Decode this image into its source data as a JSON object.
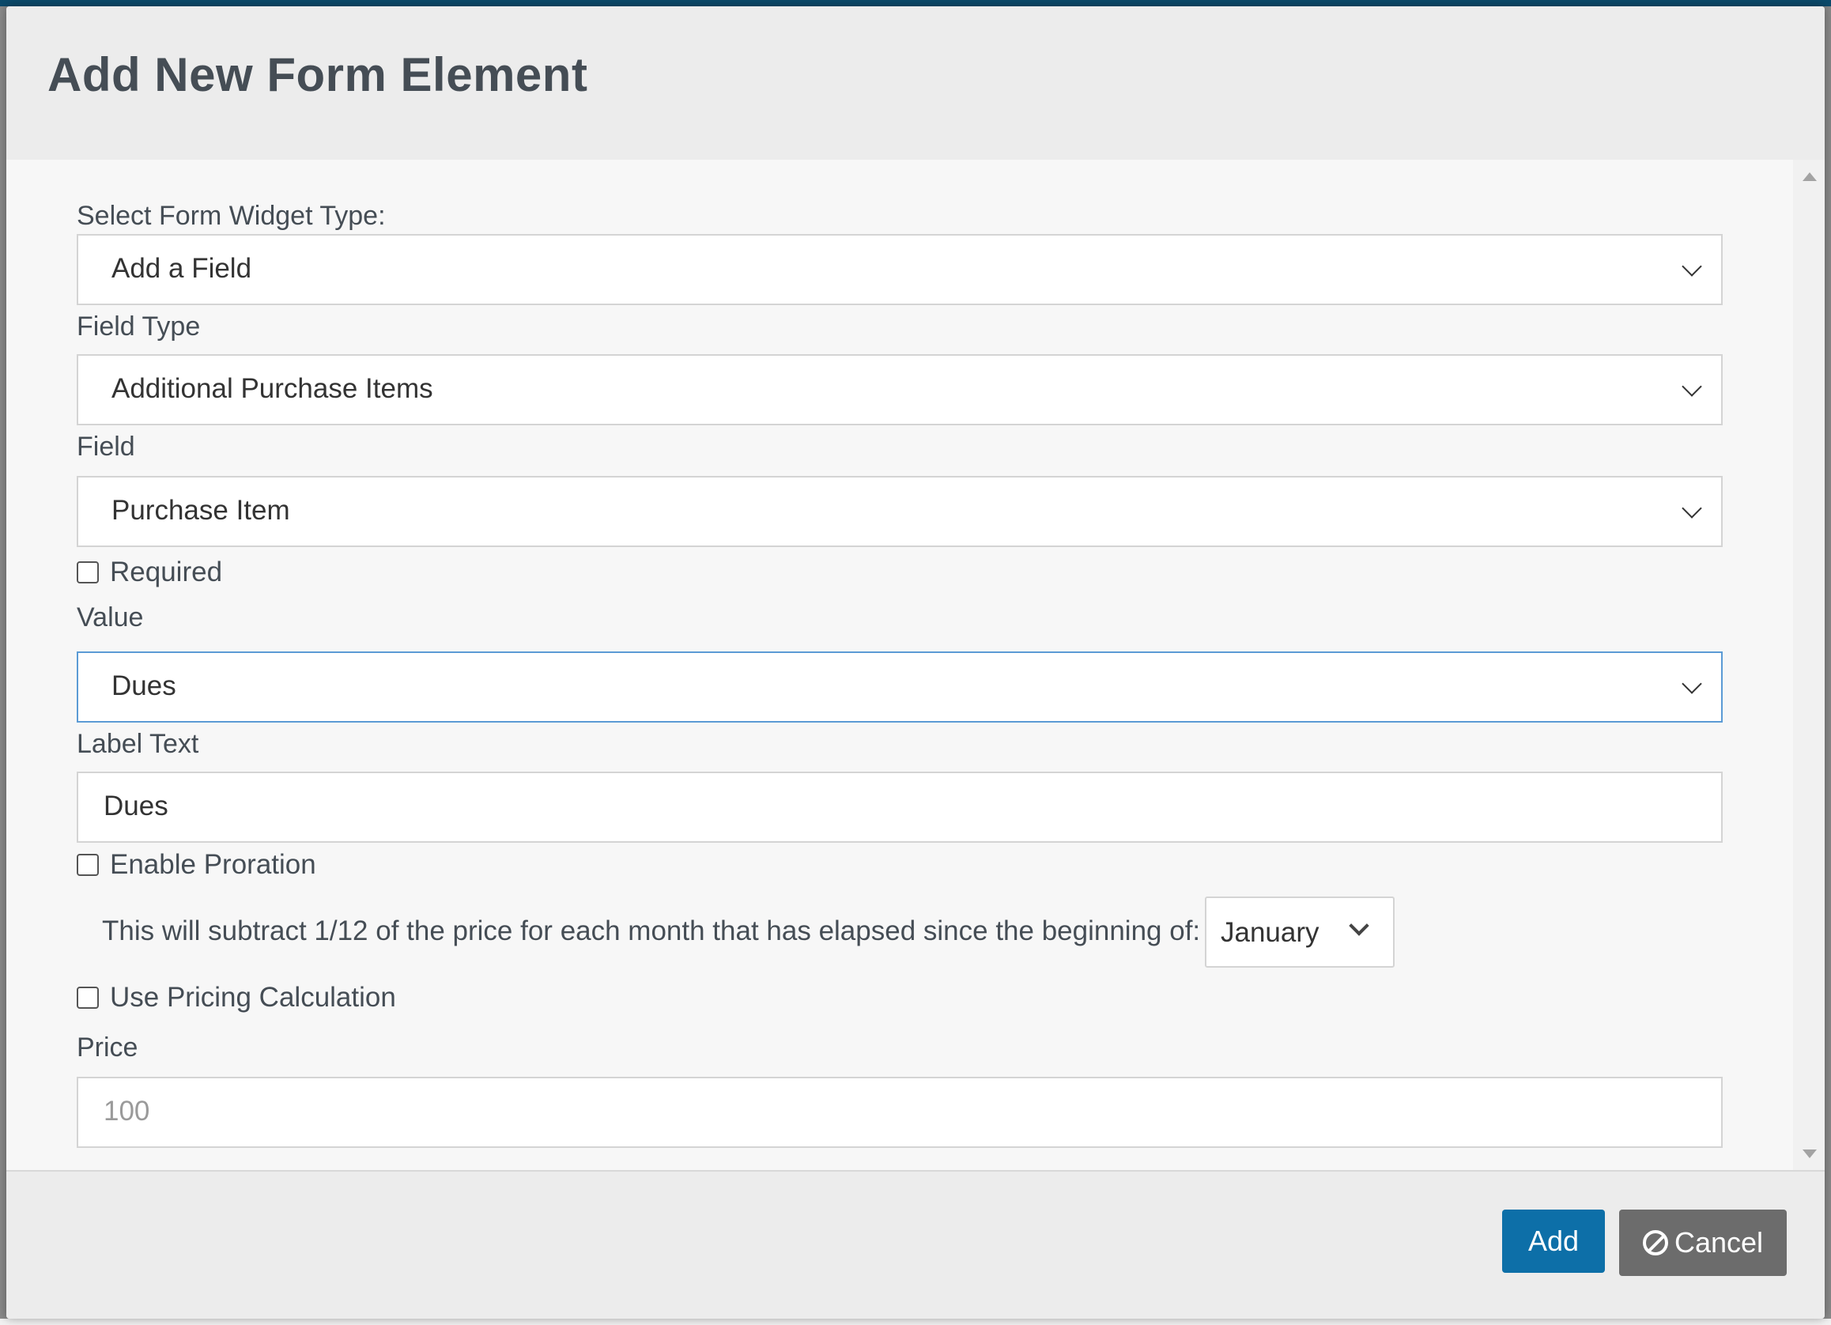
{
  "modal": {
    "title": "Add New Form Element"
  },
  "form": {
    "widget_type": {
      "label": "Select Form Widget Type:",
      "value": "Add a Field"
    },
    "field_type": {
      "label": "Field Type",
      "value": "Additional Purchase Items"
    },
    "field": {
      "label": "Field",
      "value": "Purchase Item"
    },
    "required": {
      "label": "Required",
      "checked": false
    },
    "value": {
      "label": "Value",
      "value": "Dues"
    },
    "label_text": {
      "label": "Label Text",
      "value": "Dues"
    },
    "enable_proration": {
      "label": "Enable Proration",
      "checked": false
    },
    "proration_note": "This will subtract 1/12 of the price for each month that has elapsed since the beginning of:",
    "proration_month": "January",
    "use_pricing_calculation": {
      "label": "Use Pricing Calculation",
      "checked": false
    },
    "price": {
      "label": "Price",
      "placeholder": "100"
    }
  },
  "footer": {
    "add_label": "Add",
    "cancel_label": "Cancel"
  },
  "colors": {
    "primary": "#0d6fa8",
    "secondary": "#6c6c6c",
    "title": "#454d55",
    "focus_border": "#5b9bd5"
  }
}
